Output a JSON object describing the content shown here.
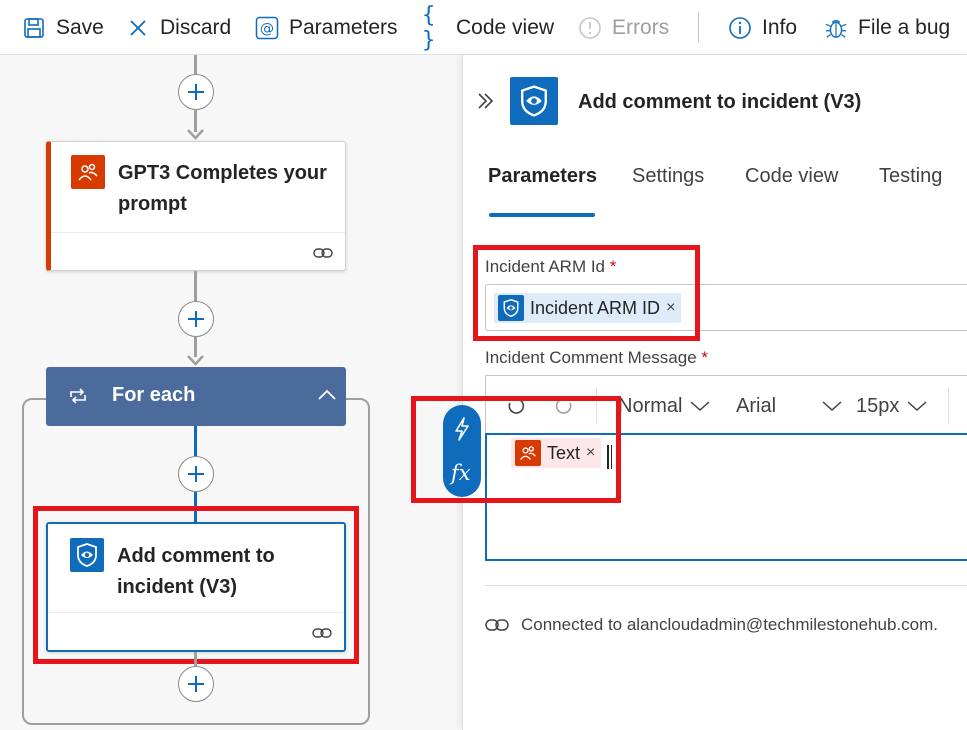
{
  "toolbar": {
    "save": "Save",
    "discard": "Discard",
    "parameters": "Parameters",
    "code_view": "Code view",
    "errors": "Errors",
    "info": "Info",
    "file_bug": "File a bug"
  },
  "canvas": {
    "gpt_card": {
      "title_line1": "GPT3 Completes your",
      "title_line2": "prompt",
      "icon": "gpt-people-icon"
    },
    "foreach": {
      "label": "For each",
      "icon": "loop-icon"
    },
    "comment_card": {
      "title_line1": "Add comment to",
      "title_line2": "incident (V3)",
      "icon": "sentinel-shield-icon"
    }
  },
  "panel": {
    "title": "Add comment to incident (V3)",
    "tabs": [
      "Parameters",
      "Settings",
      "Code view",
      "Testing"
    ],
    "fields": {
      "arm_id": {
        "label": "Incident ARM Id",
        "required_mark": "*",
        "token": "Incident ARM ID",
        "token_close": "×"
      },
      "comment": {
        "label": "Incident Comment Message",
        "required_mark": "*",
        "token": "Text",
        "token_close": "×"
      }
    },
    "editor_toolbar": {
      "paragraph": "Normal",
      "font": "Arial",
      "size": "15px"
    },
    "connection": "Connected to alancloudadmin@techmilestonehub.com."
  },
  "colors": {
    "accent": "#0f6cbd",
    "foreach_header": "#4a6b9c",
    "gpt_orange": "#d83b01",
    "highlight_red": "#e5151c"
  }
}
